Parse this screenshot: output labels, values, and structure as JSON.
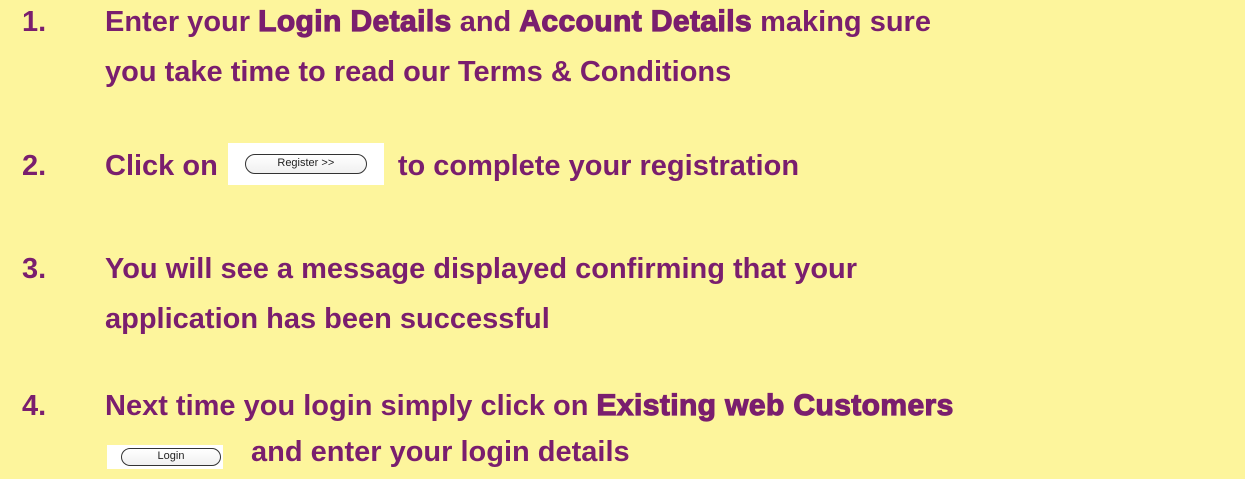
{
  "steps": [
    {
      "number": "1.",
      "pre": "Enter your ",
      "bold1": "Login Details",
      "mid": " and ",
      "bold2": "Account Details",
      "post": " making sure",
      "line2": "you take time to read our Terms & Conditions"
    },
    {
      "number": "2.",
      "pre": "Click on",
      "button_label": "Register >>",
      "post": "to complete your registration"
    },
    {
      "number": "3.",
      "line1": "You will see a message displayed confirming that your",
      "line2": "application has been successful"
    },
    {
      "number": "4.",
      "pre": "Next time you login simply click on ",
      "bold1": "Existing web Customers",
      "button_label": "Login",
      "post": "and  enter your login details"
    }
  ],
  "colors": {
    "background": "#fdf59c",
    "text": "#7a1e6e"
  }
}
